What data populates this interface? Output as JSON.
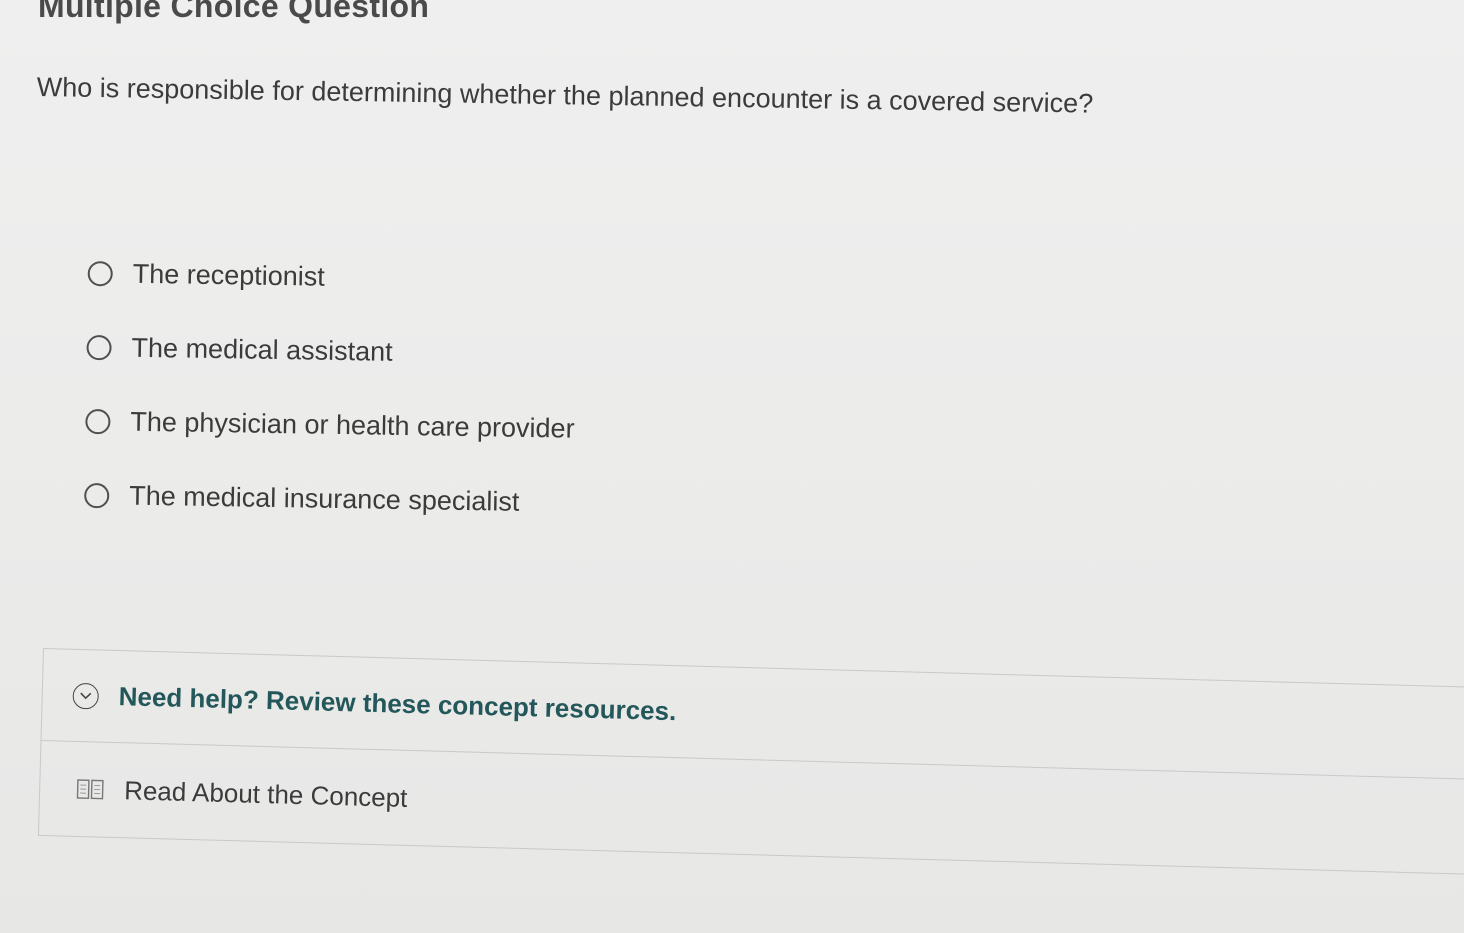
{
  "page": {
    "heading": "Multiple Choice Question"
  },
  "question": {
    "text": "Who is responsible for determining whether the planned encounter is a covered service?"
  },
  "options": [
    {
      "label": "The receptionist"
    },
    {
      "label": "The medical assistant"
    },
    {
      "label": "The physician or health care provider"
    },
    {
      "label": "The medical insurance specialist"
    }
  ],
  "help": {
    "title": "Need help? Review these concept resources.",
    "resource_label": "Read About the Concept"
  },
  "colors": {
    "accent": "#23575a",
    "text": "#3b3b3b",
    "border": "#c9c9c9"
  },
  "icons": {
    "radio": "radio-circle-icon",
    "help_toggle": "chevron-down-circle-icon",
    "resource": "book-icon"
  }
}
